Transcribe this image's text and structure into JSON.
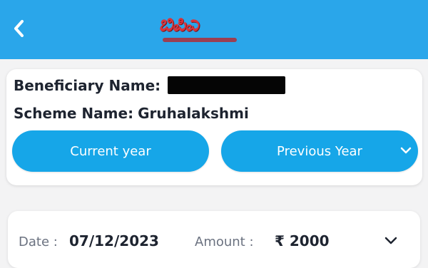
{
  "header": {
    "back_icon": "chevron-left-icon",
    "logo_text": "ಬಿಪಿಎ",
    "colors": {
      "header_bg": "#2aa6ea",
      "logo": "#d8343c"
    }
  },
  "beneficiary": {
    "name_label": "Beneficiary Name:",
    "name_value_redacted": true,
    "scheme_label": "Scheme Name:",
    "scheme_value": "Gruhalakshmi"
  },
  "year_tabs": {
    "current_label": "Current year",
    "previous_label": "Previous Year",
    "previous_icon": "chevron-down-icon",
    "colors": {
      "pill_bg": "#16a6e8",
      "pill_text": "#ffffff"
    }
  },
  "payment": {
    "date_label": "Date :",
    "date_value": "07/12/2023",
    "amount_label": "Amount :",
    "amount_value": "₹ 2000",
    "expand_icon": "chevron-down-icon"
  }
}
